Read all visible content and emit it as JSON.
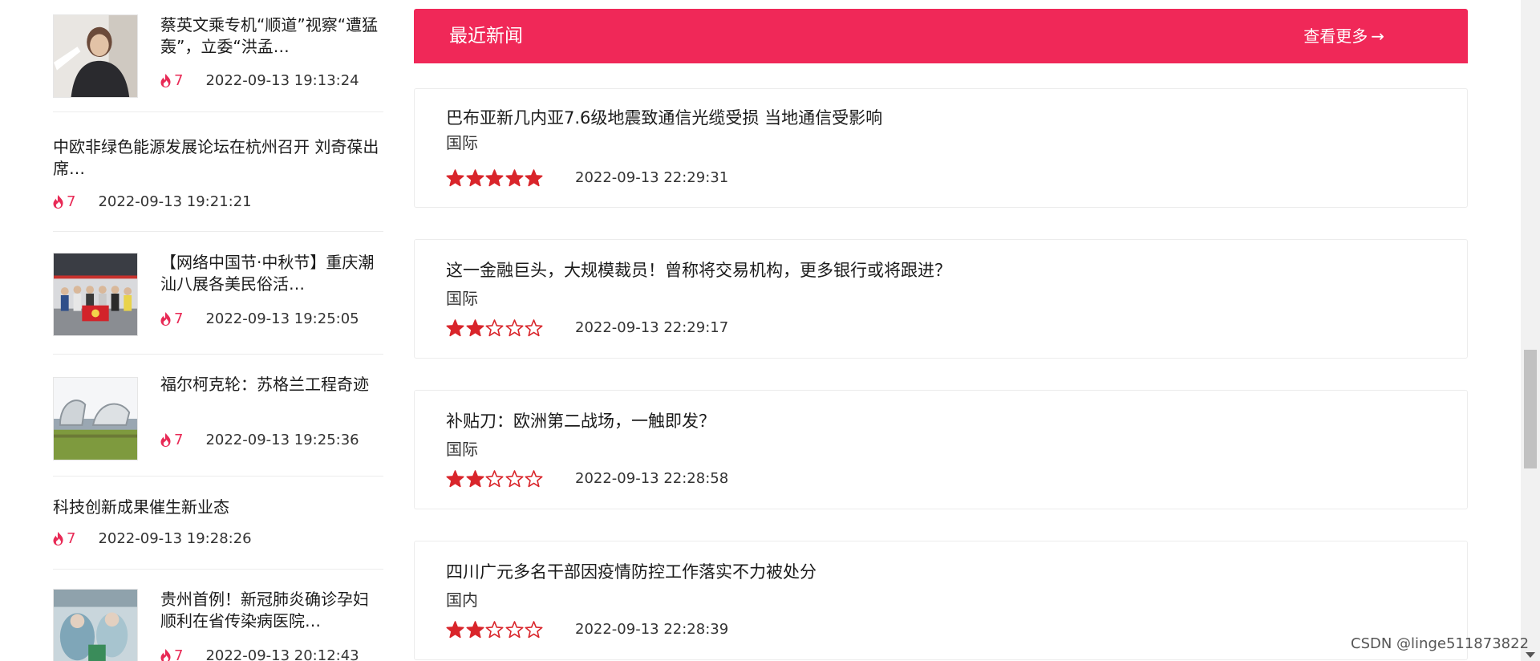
{
  "left_list": {
    "items": [
      {
        "title": "蔡英文乘专机“顺道”视察“遭猛轰”，立委“洪孟…",
        "count": "7",
        "time": "2022-09-13 19:13:24",
        "has_thumb": true,
        "thumb": "person-photo"
      },
      {
        "title": "中欧非绿色能源发展论坛在杭州召开 刘奇葆出席…",
        "count": "7",
        "time": "2022-09-13 19:21:21",
        "has_thumb": false
      },
      {
        "title": "【网络中国节·中秋节】重庆潮汕八展各美民俗活…",
        "count": "7",
        "time": "2022-09-13 19:25:05",
        "has_thumb": true,
        "thumb": "group-photo"
      },
      {
        "title": "福尔柯克轮：苏格兰工程奇迹",
        "count": "7",
        "time": "2022-09-13 19:25:36",
        "has_thumb": true,
        "thumb": "wheel-photo"
      },
      {
        "title": "科技创新成果催生新业态",
        "count": "7",
        "time": "2022-09-13 19:28:26",
        "has_thumb": false
      },
      {
        "title": "贵州首例！新冠肺炎确诊孕妇顺利在省传染病医院…",
        "count": "7",
        "time": "2022-09-13 20:12:43",
        "has_thumb": true,
        "thumb": "hospital-photo"
      }
    ]
  },
  "main": {
    "header": {
      "title": "最近新闻",
      "more": "查看更多",
      "arrow": "→"
    },
    "cards": [
      {
        "title": "巴布亚新几内亚7.6级地震致通信光缆受损 当地通信受影响",
        "category": "国际",
        "rating": 5,
        "time": "2022-09-13 22:29:31"
      },
      {
        "title": "这一金融巨头，大规模裁员！曾称将交易机构，更多银行或将跟进？",
        "category": "国际",
        "rating": 2,
        "time": "2022-09-13 22:29:17"
      },
      {
        "title": "补贴刀：欧洲第二战场，一触即发？",
        "category": "国际",
        "rating": 2,
        "time": "2022-09-13 22:28:58"
      },
      {
        "title": "四川广元多名干部因疫情防控工作落实不力被处分",
        "category": "国内",
        "rating": 2,
        "time": "2022-09-13 22:28:39"
      }
    ]
  },
  "watermark": "CSDN @linge511873822",
  "colors": {
    "accent": "#f02858",
    "star": "#d9252b",
    "fire": "#e82a56"
  },
  "icons": {
    "fire": "fire-icon",
    "star_filled": "star-filled-icon",
    "star_empty": "star-empty-icon",
    "arrow": "arrow-right-icon"
  }
}
